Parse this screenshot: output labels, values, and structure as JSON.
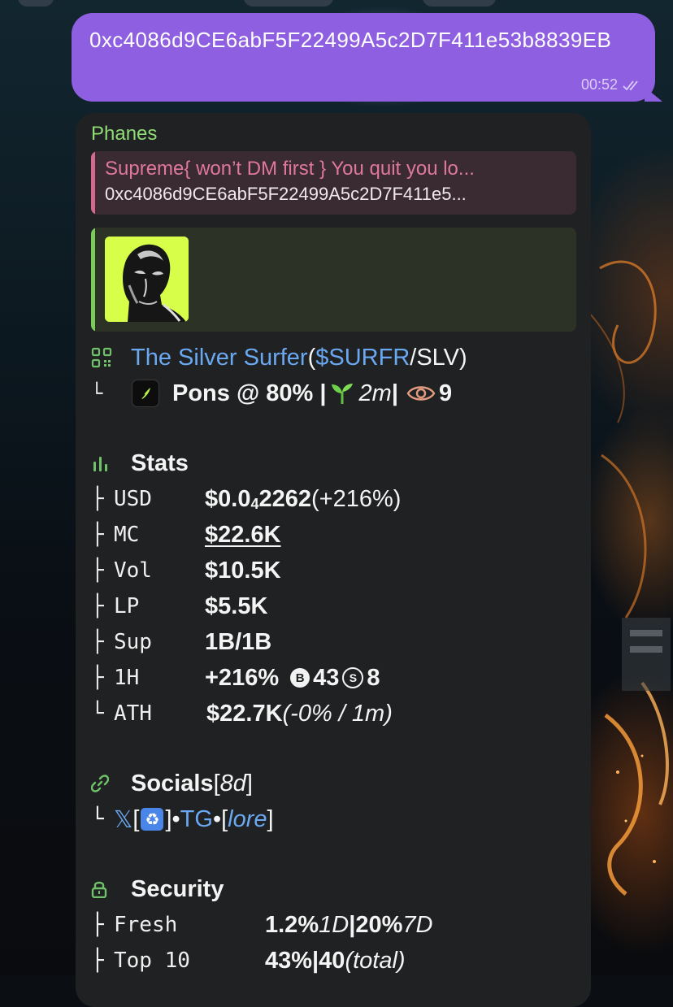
{
  "outgoing": {
    "text": "0xc4086d9CE6abF5F22499A5c2D7F411e53b8839EB",
    "time": "00:52",
    "status_icon": "double-check-icon"
  },
  "card": {
    "sender": "Phanes",
    "reply": {
      "title": "Supreme{ won’t DM first } You quit you lo...",
      "body": "0xc4086d9CE6abF5F22499A5c2D7F411e5..."
    },
    "token": {
      "name": "The Silver Surfer",
      "open_paren": " (",
      "ticker": "$SURFR",
      "pair": "/SLV)",
      "branch": "└",
      "platform": "Pons @ 80% | ",
      "age": "2m",
      "sep": " | ",
      "views": "9"
    },
    "stats": {
      "heading": "Stats",
      "rows": [
        {
          "branch": "├",
          "key": "USD",
          "value_main": "$0.0",
          "value_sub": "4",
          "value_rest": "2262",
          "value_note": " (+216%)"
        },
        {
          "branch": "├",
          "key": "MC",
          "value": "$22.6K"
        },
        {
          "branch": "├",
          "key": "Vol",
          "value": "$10.5K"
        },
        {
          "branch": "├",
          "key": "LP",
          "value": "$5.5K"
        },
        {
          "branch": "├",
          "key": "Sup",
          "value": "1B/1B"
        },
        {
          "branch": "├",
          "key": "1H",
          "value": "+216%",
          "buys_label": "B",
          "buys": "43",
          "sells_label": "S",
          "sells": "8"
        },
        {
          "branch": "└",
          "key": "ATH",
          "value": "$22.7K",
          "value_note": " (-0% / 1m)"
        }
      ]
    },
    "socials": {
      "heading": "Socials",
      "age_open": " [",
      "age": "8d",
      "age_close": "]",
      "branch": "└",
      "x_label": "𝕏",
      "bracket_open": " [",
      "bracket_close": "]",
      "dot1": " • ",
      "tg": "TG",
      "dot2": " • ",
      "lore_open": "[",
      "lore": "lore",
      "lore_close": "]"
    },
    "security": {
      "heading": "Security",
      "rows": [
        {
          "branch": "├",
          "key": "Fresh",
          "v1": "1.2%",
          "v1_note": " 1D",
          "sep": " | ",
          "v2": "20%",
          "v2_note": " 7D"
        },
        {
          "branch": "├",
          "key": "Top 10",
          "v1": "43%",
          "v1_note": "",
          "sep": " | ",
          "v2": "40",
          "v2_note": " (total)"
        }
      ]
    }
  },
  "colors": {
    "outgoing_bubble": "#8e5fe0",
    "card_bg": "#202122",
    "sender": "#8fdc76",
    "link": "#6aa8f2",
    "reply_accent": "#d26a8f",
    "preview_accent": "#7ccc5a"
  }
}
